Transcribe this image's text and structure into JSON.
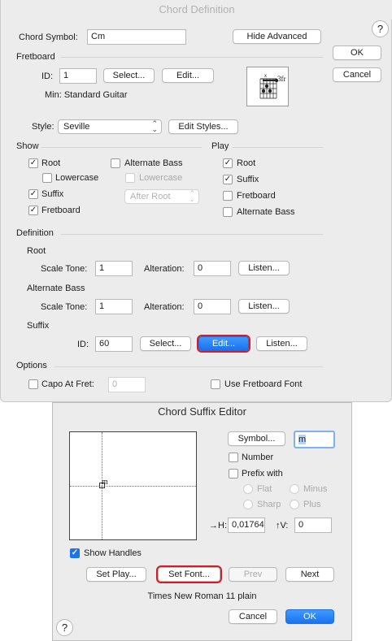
{
  "chord_definition": {
    "title": "Chord Definition",
    "help_label": "?",
    "chord_symbol_label": "Chord Symbol:",
    "chord_symbol_value": "Cm",
    "hide_advanced_label": "Hide Advanced",
    "ok_label": "OK",
    "cancel_label": "Cancel",
    "fretboard": {
      "section_label": "Fretboard",
      "id_label": "ID:",
      "id_value": "1",
      "select_label": "Select...",
      "edit_label": "Edit...",
      "description": "Min: Standard Guitar",
      "diagram_fret_text": "3fr",
      "style_label": "Style:",
      "style_value": "Seville",
      "edit_styles_label": "Edit Styles..."
    },
    "show": {
      "section_label": "Show",
      "root_label": "Root",
      "root_checked": true,
      "lowercase_label": "Lowercase",
      "suffix_label": "Suffix",
      "suffix_checked": true,
      "fretboard_label": "Fretboard",
      "fretboard_checked": true,
      "alternate_bass_label": "Alternate Bass",
      "alt_lowercase_label": "Lowercase",
      "after_root_value": "After Root"
    },
    "play": {
      "section_label": "Play",
      "root_label": "Root",
      "root_checked": true,
      "suffix_label": "Suffix",
      "suffix_checked": true,
      "fretboard_label": "Fretboard",
      "alternate_bass_label": "Alternate Bass"
    },
    "definition": {
      "section_label": "Definition",
      "root_label": "Root",
      "root_scale_tone_label": "Scale Tone:",
      "root_scale_tone_value": "1",
      "root_alteration_label": "Alteration:",
      "root_alteration_value": "0",
      "root_listen_label": "Listen...",
      "alt_bass_label": "Alternate Bass",
      "alt_scale_tone_label": "Scale Tone:",
      "alt_scale_tone_value": "1",
      "alt_alteration_label": "Alteration:",
      "alt_alteration_value": "0",
      "alt_listen_label": "Listen...",
      "suffix_label": "Suffix",
      "suffix_id_label": "ID:",
      "suffix_id_value": "60",
      "suffix_select_label": "Select...",
      "suffix_edit_label": "Edit...",
      "suffix_listen_label": "Listen..."
    },
    "options": {
      "section_label": "Options",
      "capo_label": "Capo At Fret:",
      "capo_value": "0",
      "use_fretboard_font_label": "Use Fretboard Font"
    }
  },
  "suffix_editor": {
    "title": "Chord Suffix Editor",
    "preview_glyph": "m",
    "symbol_label": "Symbol...",
    "symbol_value": "m",
    "number_label": "Number",
    "prefix_label": "Prefix with",
    "flat_label": "Flat",
    "minus_label": "Minus",
    "sharp_label": "Sharp",
    "plus_label": "Plus",
    "h_label": "→H:",
    "h_value": "0,01764",
    "v_label": "↑V:",
    "v_value": "0",
    "show_handles_label": "Show Handles",
    "show_handles_checked": true,
    "set_play_label": "Set Play...",
    "set_font_label": "Set Font...",
    "prev_label": "Prev",
    "next_label": "Next",
    "font_info": "Times New Roman 11 plain",
    "cancel_label": "Cancel",
    "ok_label": "OK",
    "help_label": "?"
  },
  "colors": {
    "accent_blue": "#1c73ee",
    "highlight_ring": "#d31d26",
    "dialog_bg": "#ececec"
  }
}
